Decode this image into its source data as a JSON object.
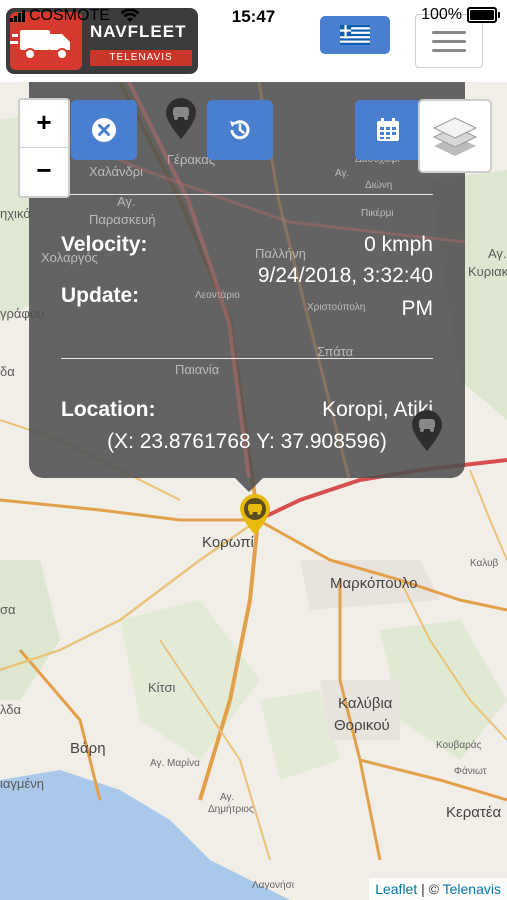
{
  "status_bar": {
    "carrier": "COSMOTE",
    "time": "15:47",
    "battery": "100%"
  },
  "header": {
    "logo_brand": "NAVFLEET",
    "logo_sub": "TELENAVIS",
    "language_flag": "greek-flag",
    "menu_icon": "hamburger-icon"
  },
  "map_controls": {
    "zoom_in": "+",
    "zoom_out": "−",
    "layers_icon": "layers-icon"
  },
  "popup": {
    "buttons": [
      "close-circle-icon",
      "history-icon",
      "calendar-icon"
    ],
    "velocity_label": "Velocity:",
    "velocity_value": "0 kmph",
    "update_label": "Update:",
    "update_value_line1": "9/24/2018, 3:32:40",
    "update_value_line2": "PM",
    "location_label": "Location:",
    "location_value": "Koropi, Atiki",
    "coordinates": "(X: 23.8761768 Y: 37.908596)"
  },
  "map_labels": {
    "kalandri": "Χαλάνδρι",
    "gerakas": "Γέρακας",
    "ag_paraskevi_1": "Αγ.",
    "ag_paraskevi_2": "Παρασκευή",
    "cholargos": "Χολαργός",
    "ichiko": "ηχικό",
    "grafou": "γράφου",
    "pallini": "Παλλήνη",
    "leontario": "Λεοντάριο",
    "christoupoli": "Χριστούπολη",
    "spata": "Σπάτα",
    "paiania": "Παιανία",
    "dasoper": "Δασοχώρι",
    "ag_label": "Αγ.",
    "dioni": "Διώνη",
    "pikermi": "Πικέρμι",
    "ag_right": "Αγ.",
    "kyriaki": "Κυριακή",
    "koropi": "Κορωπί",
    "markopoulo": "Μαρκόπουλο",
    "kalyvia": "Καλύβια",
    "thorikou": "Θορικού",
    "kitsi": "Κίτσι",
    "vari": "Βάρη",
    "ag_marina": "Αγ. Μαρίνα",
    "ag_dimitrios_1": "Αγ.",
    "ag_dimitrios_2": "Δημήτριος",
    "kouvaras": "Κουβαράς",
    "fanari": "Φάνιωτ",
    "keratea": "Κερατέα",
    "kaloudi": "Καλυβ",
    "lagonisi": "Λαγονήσι",
    "ilioupoli": "ιαγμένη",
    "sa": "σα",
    "da": "δα",
    "lda": "λδα"
  },
  "attribution": {
    "leaflet": "Leaflet",
    "separator": " | © ",
    "telenavis": "Telenavis"
  },
  "colors": {
    "accent_blue": "#4a7fcf",
    "logo_red": "#d63a2f",
    "popup_bg": "#505050",
    "marker_yellow": "#e8b90f",
    "sea": "#aac8e9"
  }
}
